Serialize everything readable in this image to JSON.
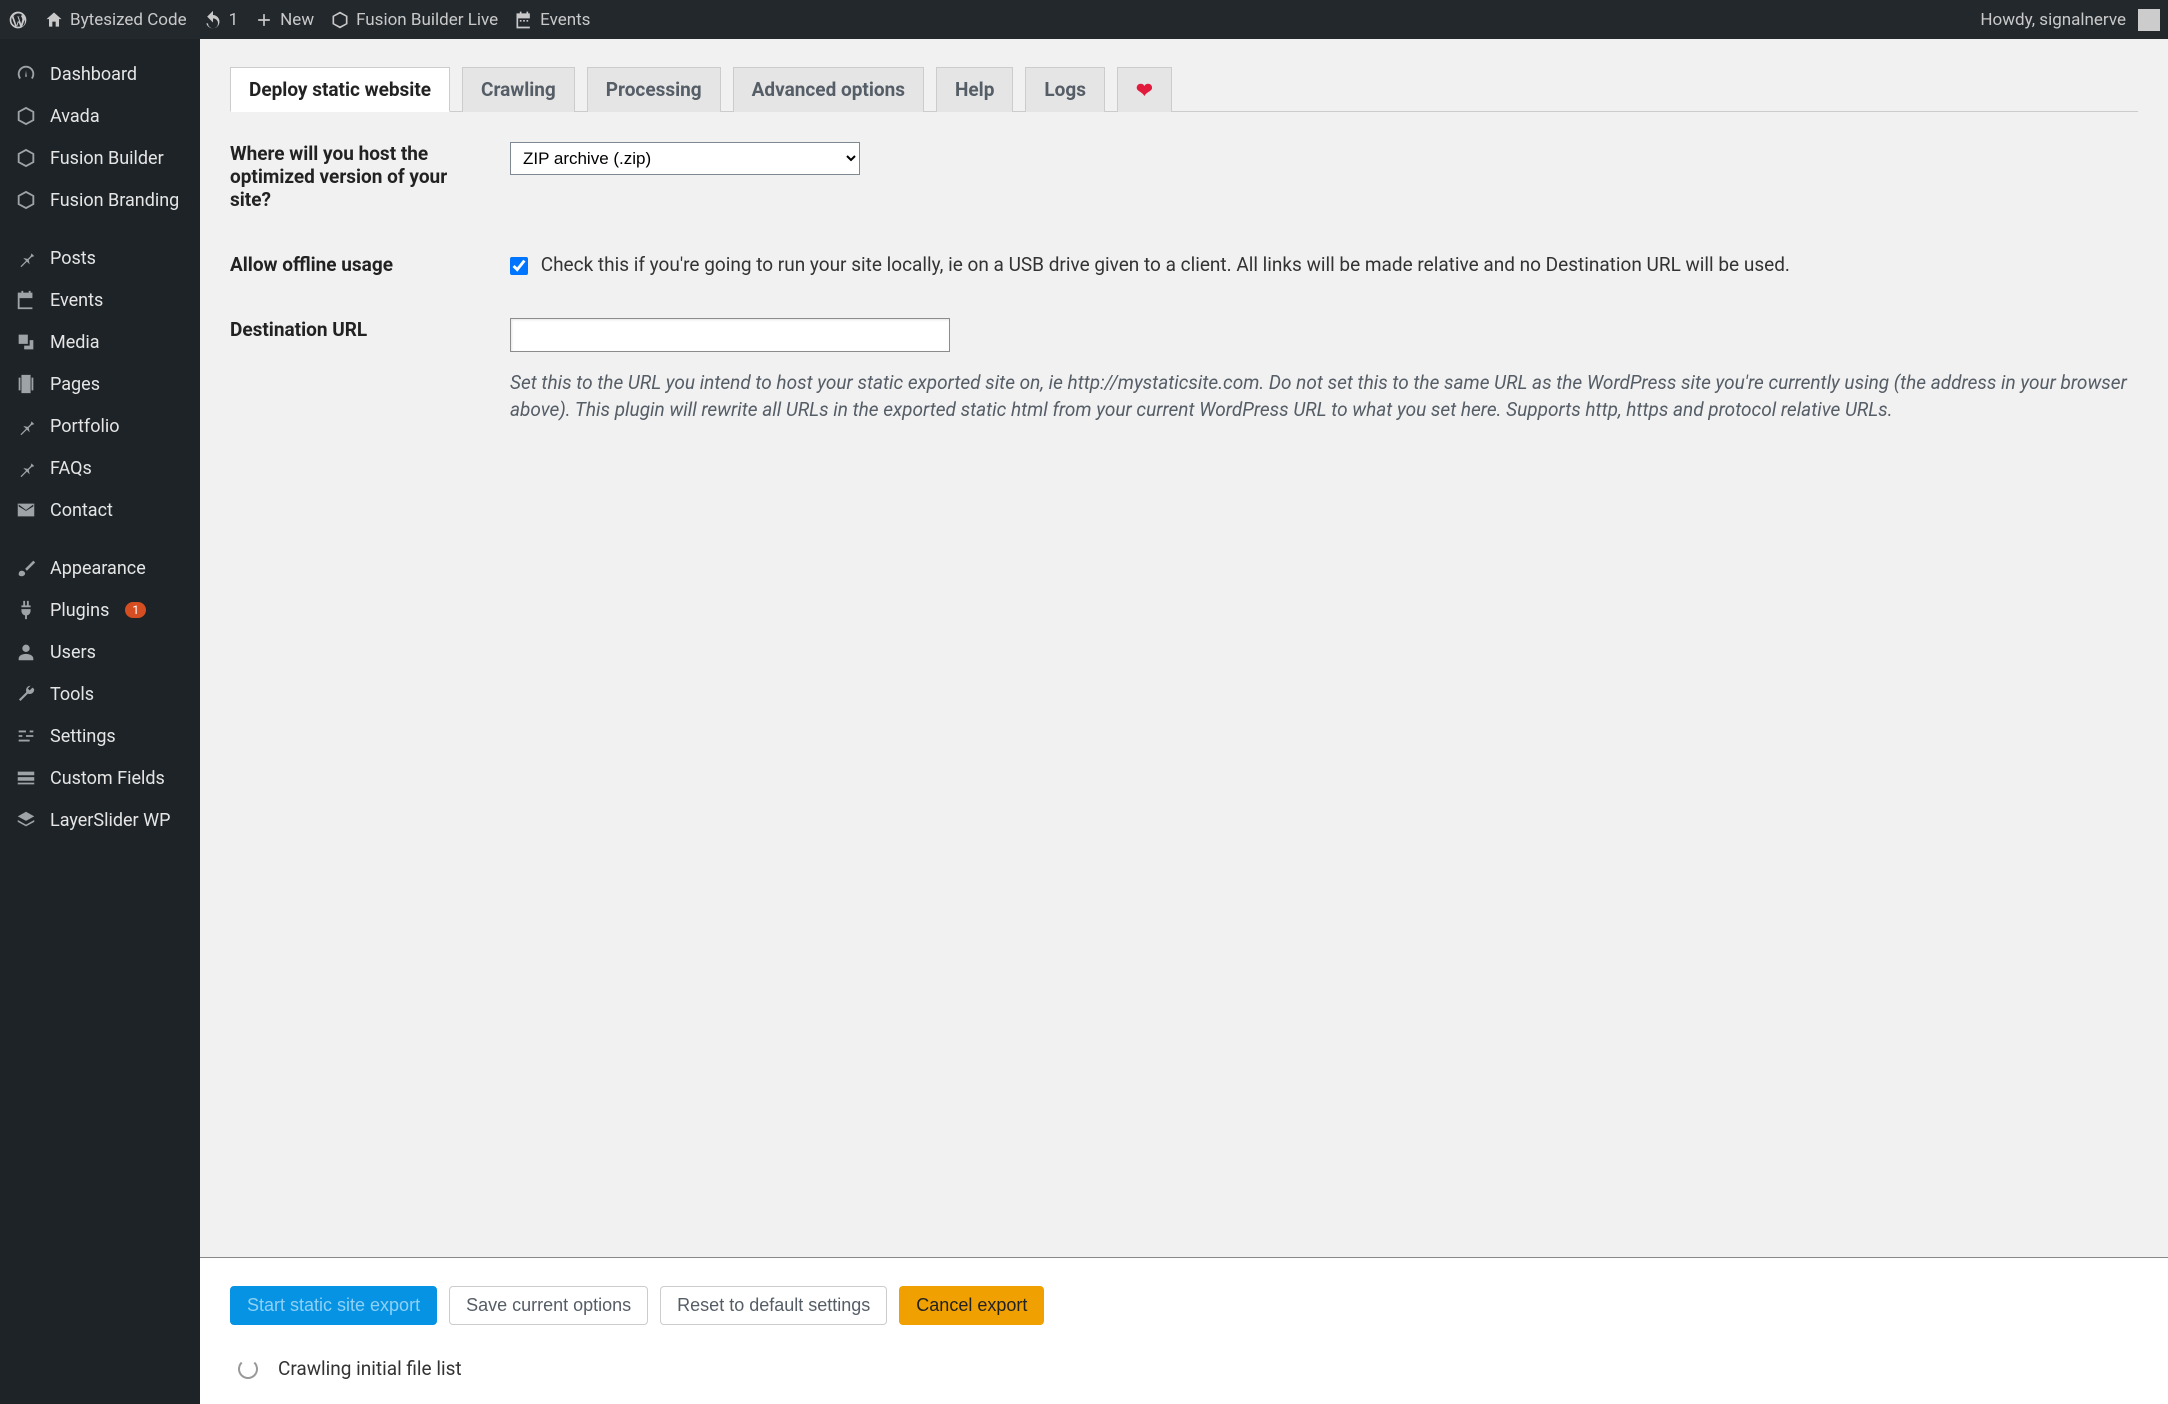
{
  "adminbar": {
    "site_name": "Bytesized Code",
    "update_count": "1",
    "new_label": "New",
    "fusion_builder": "Fusion Builder Live",
    "events": "Events",
    "howdy": "Howdy, signalnerve"
  },
  "sidebar": {
    "items": [
      {
        "icon": "dashboard",
        "label": "Dashboard"
      },
      {
        "icon": "avada",
        "label": "Avada"
      },
      {
        "icon": "fusion",
        "label": "Fusion Builder"
      },
      {
        "icon": "fusion",
        "label": "Fusion Branding"
      },
      {
        "sep": true
      },
      {
        "icon": "pin",
        "label": "Posts"
      },
      {
        "icon": "calendar",
        "label": "Events"
      },
      {
        "icon": "media",
        "label": "Media"
      },
      {
        "icon": "pages",
        "label": "Pages"
      },
      {
        "icon": "pin",
        "label": "Portfolio"
      },
      {
        "icon": "pin",
        "label": "FAQs"
      },
      {
        "icon": "mail",
        "label": "Contact"
      },
      {
        "sep": true
      },
      {
        "icon": "brush",
        "label": "Appearance"
      },
      {
        "icon": "plug",
        "label": "Plugins",
        "badge": "1"
      },
      {
        "icon": "user",
        "label": "Users"
      },
      {
        "icon": "wrench",
        "label": "Tools"
      },
      {
        "icon": "sliders",
        "label": "Settings"
      },
      {
        "icon": "fields",
        "label": "Custom Fields"
      },
      {
        "icon": "layers",
        "label": "LayerSlider WP"
      }
    ]
  },
  "tabs": [
    {
      "label": "Deploy static website",
      "active": true
    },
    {
      "label": "Crawling"
    },
    {
      "label": "Processing"
    },
    {
      "label": "Advanced options"
    },
    {
      "label": "Help"
    },
    {
      "label": "Logs"
    }
  ],
  "form": {
    "host_label": "Where will you host the optimized version of your site?",
    "host_value": "ZIP archive (.zip)",
    "offline_label": "Allow offline usage",
    "offline_checked": true,
    "offline_desc": "Check this if you're going to run your site locally, ie on a USB drive given to a client. All links will be made relative and no Destination URL will be used.",
    "dest_label": "Destination URL",
    "dest_value": "",
    "dest_help": "Set this to the URL you intend to host your static exported site on, ie http://mystaticsite.com. Do not set this to the same URL as the WordPress site you're currently using (the address in your browser above). This plugin will rewrite all URLs in the exported static html from your current WordPress URL to what you set here. Supports http, https and protocol relative URLs."
  },
  "actions": {
    "start": "Start static site export",
    "save": "Save current options",
    "reset": "Reset to default settings",
    "cancel": "Cancel export",
    "status": "Crawling initial file list"
  }
}
